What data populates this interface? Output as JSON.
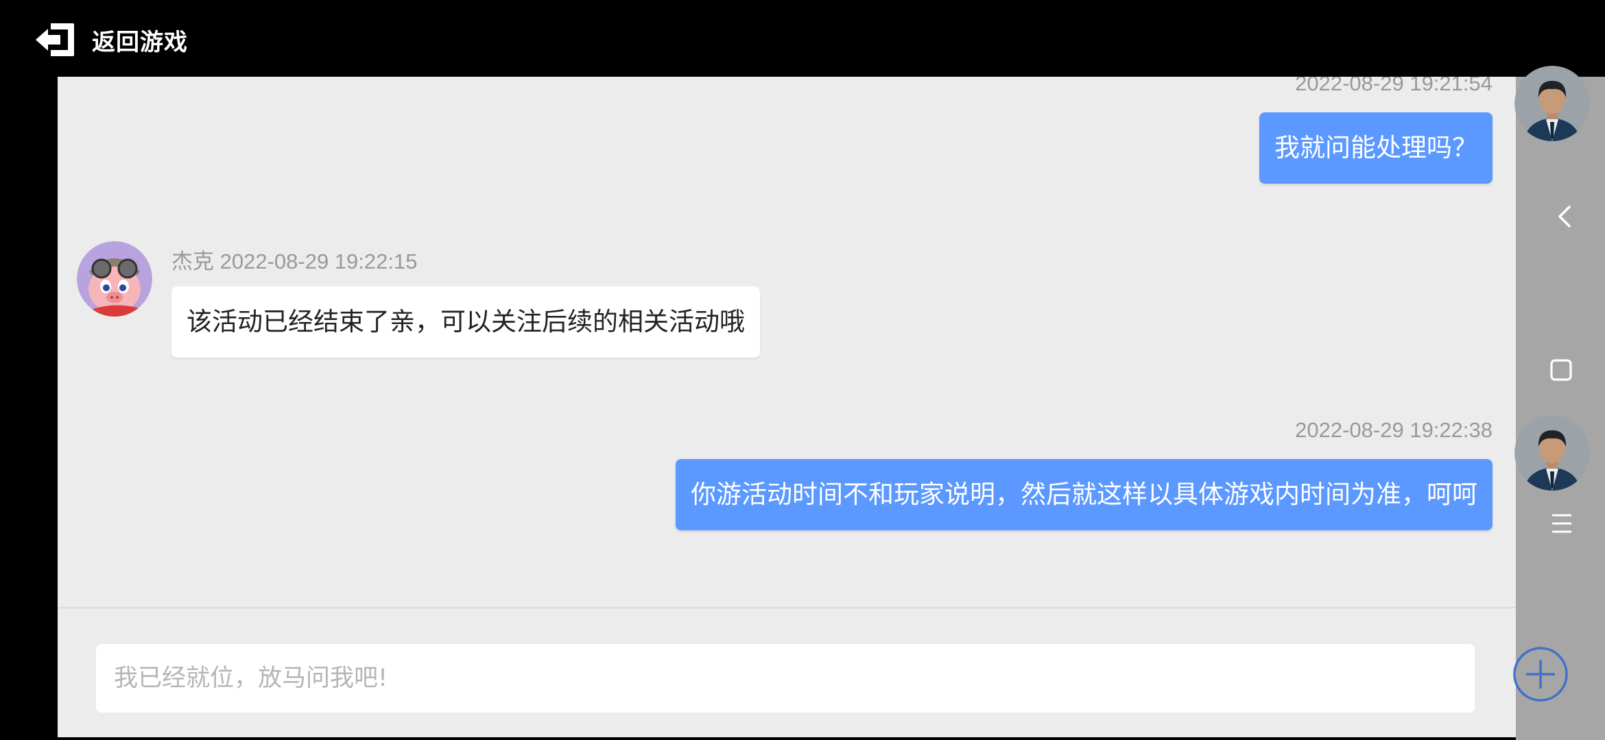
{
  "header": {
    "back_label": "返回游戏"
  },
  "messages": [
    {
      "sender": "me",
      "timestamp": "2022-08-29 19:21:54",
      "text": "我就问能处理吗？"
    },
    {
      "sender": "agent",
      "name_timestamp": "杰克 2022-08-29 19:22:15",
      "text": "该活动已经结束了亲，可以关注后续的相关活动哦"
    },
    {
      "sender": "me",
      "timestamp": "2022-08-29 19:22:38",
      "text": "你游活动时间不和玩家说明，然后就这样以具体游戏内时间为准，呵呵"
    }
  ],
  "input": {
    "placeholder": "我已经就位，放马问我吧!"
  },
  "side_nav": [
    "back-arrow-icon",
    "home-square-icon",
    "menu-lines-icon"
  ],
  "colors": {
    "my_bubble": "#5b98ff",
    "chat_background": "#ececec",
    "side_bar": "#a6a6a6"
  }
}
